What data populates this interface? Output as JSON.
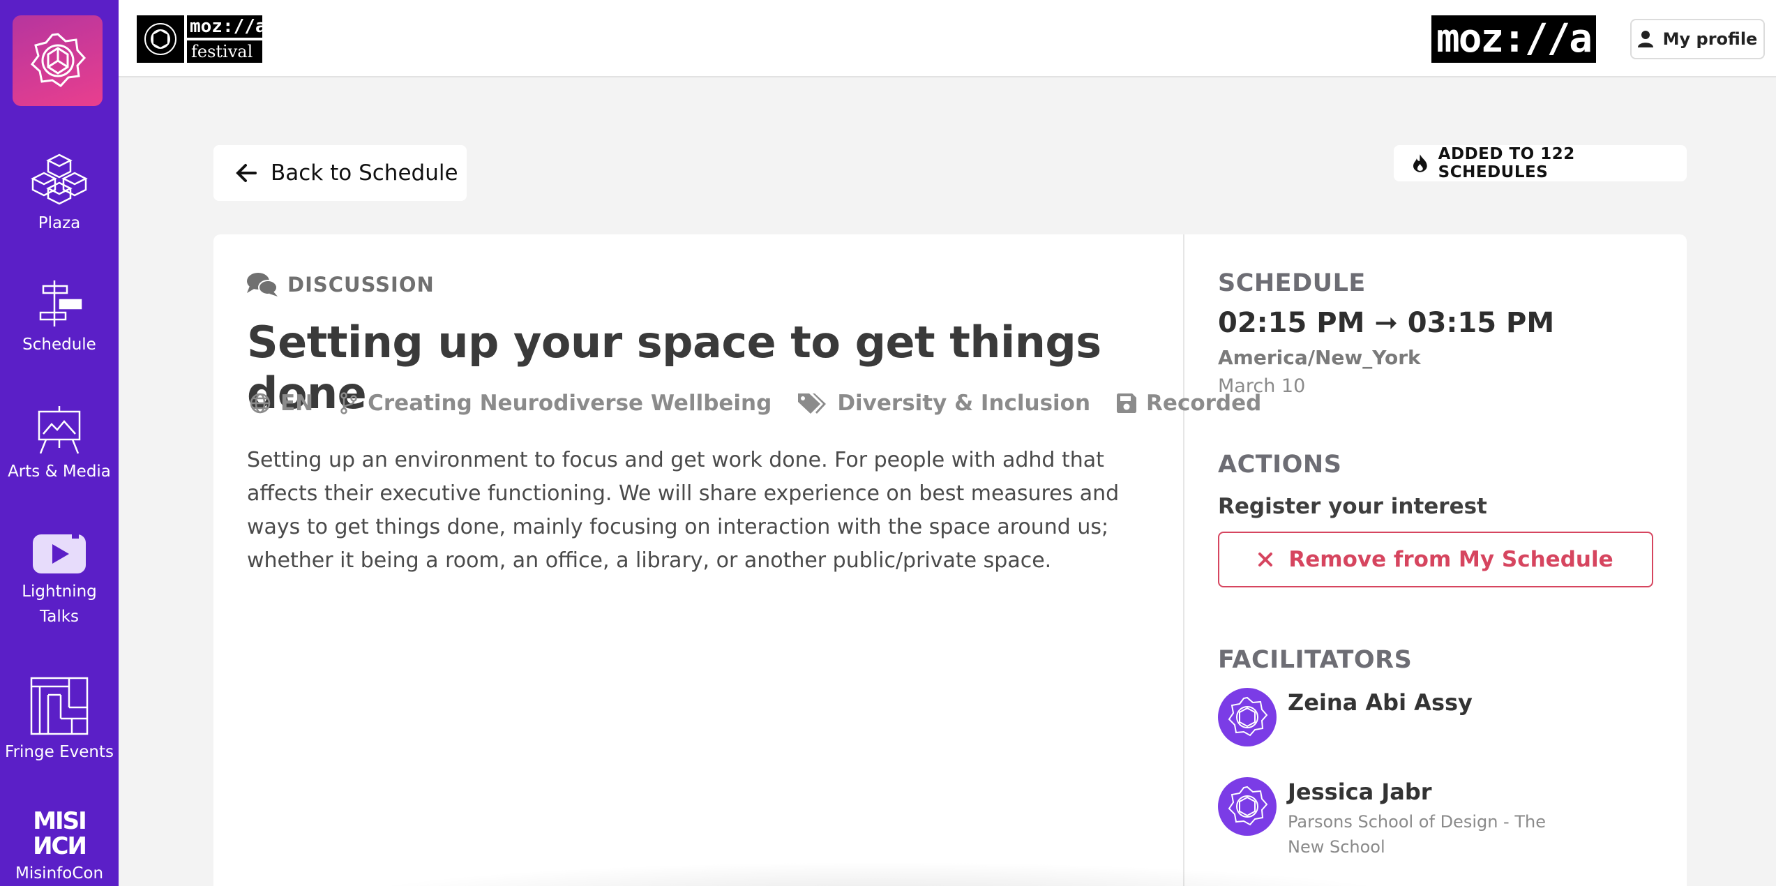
{
  "sidebar": {
    "items": [
      {
        "label": "Plaza",
        "icon": "plaza-icon"
      },
      {
        "label": "Schedule",
        "icon": "schedule-icon"
      },
      {
        "label": "Arts & Media",
        "icon": "arts-media-icon"
      },
      {
        "label": "Lightning Talks",
        "icon": "lightning-talks-icon"
      },
      {
        "label": "Fringe Events",
        "icon": "fringe-events-icon"
      },
      {
        "label": "MisinfoCon",
        "icon": "misinfocon-icon"
      }
    ]
  },
  "header": {
    "logo_top": "moz://a",
    "logo_bottom": "festival",
    "brand": "moz://a",
    "profile_label": "My profile"
  },
  "nav": {
    "back_label": "Back to Schedule",
    "added_label": "ADDED TO 122 SCHEDULES"
  },
  "session": {
    "type": "DISCUSSION",
    "title": "Setting up your space to get things done",
    "language": "EN",
    "space": "Creating Neurodiverse Wellbeing",
    "tag": "Diversity & Inclusion",
    "recording": "Recorded",
    "description": "Setting up an environment to focus and get work done. For people with adhd that affects their executive functioning. We will share experience on best measures and ways to get things done, mainly focusing on interaction with the space around us; whether it being a room, an office, a library, or another public/private space."
  },
  "schedule": {
    "heading": "SCHEDULE",
    "start": "02:15 PM",
    "arrow": "➞",
    "end": "03:15 PM",
    "timezone": "America/New_York",
    "date": "March 10"
  },
  "actions": {
    "heading": "ACTIONS",
    "register_label": "Register your interest",
    "remove_label": "Remove from My Schedule"
  },
  "facilitators": {
    "heading": "FACILITATORS",
    "people": [
      {
        "name": "Zeina Abi Assy",
        "affiliation": ""
      },
      {
        "name": "Jessica Jabr",
        "affiliation": "Parsons School of Design - The New School"
      }
    ]
  },
  "colors": {
    "sidebar": "#5b1fc7",
    "accent_remove": "#d6455f",
    "avatar": "#7b3ce6"
  }
}
